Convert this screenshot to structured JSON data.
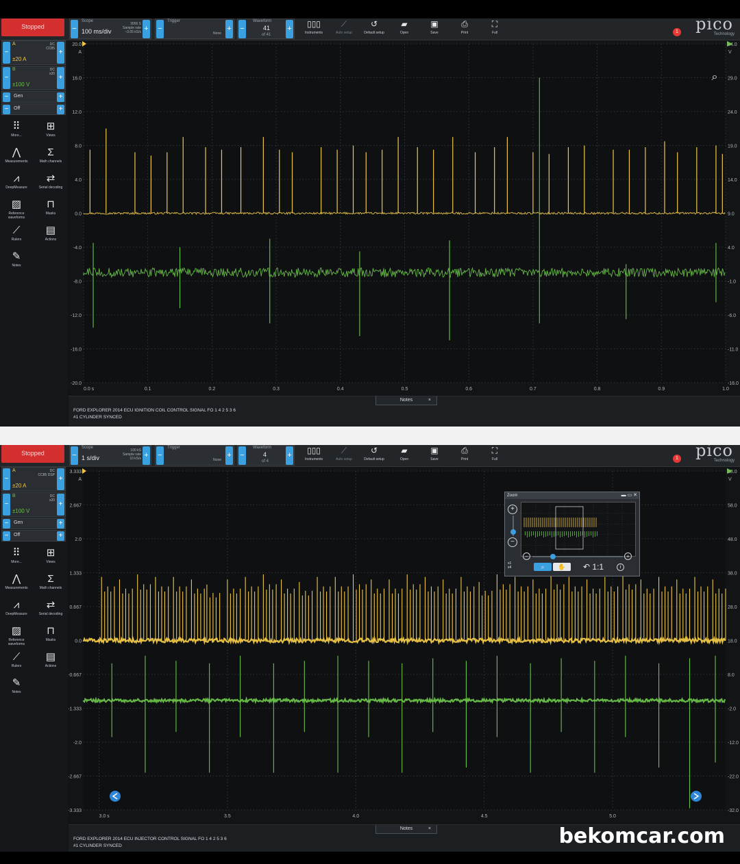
{
  "watermark": "bekomcar.com",
  "panels": [
    {
      "id": "top",
      "status": "Stopped",
      "timebase": {
        "label": "Scope",
        "value": "100 ms/div",
        "samples": "3056 S",
        "sample_rate_label": "Sample rate",
        "sample_rate": "~3.05 kS/s"
      },
      "trigger": {
        "label": "Trigger",
        "mode": "None"
      },
      "waveform": {
        "label": "Waveform",
        "index": "41",
        "of": "of 41"
      },
      "tools": [
        {
          "label": "Instruments",
          "icon": "instruments-icon",
          "dim": false
        },
        {
          "label": "Auto setup",
          "icon": "wand-icon",
          "dim": true
        },
        {
          "label": "Default setup",
          "icon": "undo-icon",
          "dim": false
        },
        {
          "label": "Open",
          "icon": "folder-icon",
          "dim": false
        },
        {
          "label": "Save",
          "icon": "save-icon",
          "dim": false
        },
        {
          "label": "Print",
          "icon": "print-icon",
          "dim": false
        },
        {
          "label": "Full",
          "icon": "fullscreen-icon",
          "dim": false
        }
      ],
      "logo": "pico",
      "logo_sub": "Technology",
      "alert_count": "1",
      "channels": [
        {
          "name": "A",
          "coupling": "DC",
          "extra": "CC85",
          "range": "±20 A",
          "color": "#f0c848"
        },
        {
          "name": "B",
          "coupling": "DC",
          "extra": "x20",
          "range": "±100 V",
          "color": "#6cc24a"
        }
      ],
      "generator": {
        "label": "Gen",
        "state": "Off"
      },
      "sidebar_buttons": [
        {
          "label": "More...",
          "glyph": "⠿",
          "icon": "more-icon"
        },
        {
          "label": "Views",
          "glyph": "⊞",
          "icon": "views-icon"
        },
        {
          "label": "Measurements",
          "glyph": "⋀",
          "icon": "measurements-icon"
        },
        {
          "label": "Math channels",
          "glyph": "Σ",
          "icon": "math-channels-icon"
        },
        {
          "label": "DeepMeasure",
          "glyph": "⩘",
          "icon": "deepmeasure-icon"
        },
        {
          "label": "Serial decoding",
          "glyph": "⇄",
          "icon": "serial-decoding-icon"
        },
        {
          "label": "Reference waveforms",
          "glyph": "▨",
          "icon": "reference-waveforms-icon"
        },
        {
          "label": "Masks",
          "glyph": "⊓",
          "icon": "masks-icon"
        },
        {
          "label": "Rulers",
          "glyph": "⟋",
          "icon": "rulers-icon"
        },
        {
          "label": "Actions",
          "glyph": "▤",
          "icon": "actions-icon"
        },
        {
          "label": "Notes",
          "glyph": "✎",
          "icon": "notes-icon"
        }
      ],
      "notes_label": "Notes",
      "notes": [
        "FORD EXPLORER 2014 ECU IGNITION COIL CONTROL SIGNAL FO 1 4 2 5 3 6",
        "#1 CYLINDER SYNCED"
      ],
      "chart_data": {
        "type": "line",
        "x_ticks": [
          "0.0 s",
          "0.1",
          "0.2",
          "0.3",
          "0.4",
          "0.5",
          "0.6",
          "0.7",
          "0.8",
          "0.9",
          "1.0"
        ],
        "xlim": [
          0,
          1.0
        ],
        "y_left_unit": "A",
        "y_left_ticks": [
          "20.0",
          "16.0",
          "12.0",
          "8.0",
          "4.0",
          "0.0",
          "-4.0",
          "-8.0",
          "-12.0",
          "-16.0",
          "-20.0"
        ],
        "ylim_left": [
          -20,
          20
        ],
        "y_right_unit": "V",
        "y_right_ticks": [
          "34.0",
          "29.0",
          "24.0",
          "19.0",
          "14.0",
          "9.0",
          "4.0",
          "-1.0",
          "-6.0",
          "-11.0",
          "-16.0"
        ],
        "grid": true,
        "series": [
          {
            "name": "A",
            "color": "#f0c848",
            "baseline": 0.0,
            "noise": 0.12,
            "spike_x": [
              0.01,
              0.035,
              0.08,
              0.105,
              0.13,
              0.155,
              0.19,
              0.215,
              0.245,
              0.28,
              0.305,
              0.325,
              0.37,
              0.395,
              0.42,
              0.44,
              0.465,
              0.49,
              0.52,
              0.545,
              0.575,
              0.61,
              0.64,
              0.66,
              0.7,
              0.725,
              0.755,
              0.78,
              0.825,
              0.85,
              0.875,
              0.905,
              0.925,
              0.955,
              0.985,
              0.995
            ],
            "spike_y": [
              7.5,
              10.0,
              7.2,
              6.8,
              7.2,
              9.0,
              7.8,
              7.5,
              7.8,
              9.0,
              7.5,
              7.2,
              7.8,
              7.5,
              8.0,
              7.2,
              7.5,
              9.0,
              7.8,
              7.5,
              9.0,
              7.2,
              7.8,
              9.0,
              7.2,
              7.0,
              7.8,
              8.0,
              7.5,
              7.5,
              7.8,
              8.5,
              7.2,
              7.8,
              8.0,
              7.0
            ]
          },
          {
            "name": "B",
            "color": "#6cc24a",
            "baseline": -7.0,
            "noise": 0.55,
            "spike_x": [
              0.015,
              0.15,
              0.29,
              0.43,
              0.57,
              0.71,
              0.845,
              0.985
            ],
            "spike_up": [
              -3.5,
              -4.0,
              -3.0,
              -4.5,
              -3.2,
              16.0,
              -6.0,
              -3.5
            ],
            "spike_down": [
              -13.5,
              -11.2,
              -13.0,
              -14.5,
              -15.0,
              -13.0,
              -12.5,
              -10.5
            ]
          }
        ]
      }
    },
    {
      "id": "bottom",
      "status": "Stopped",
      "timebase": {
        "label": "Scope",
        "value": "1 s/div",
        "samples": "100 kS",
        "sample_rate_label": "Sample rate",
        "sample_rate": "10 kS/s"
      },
      "trigger": {
        "label": "Trigger",
        "mode": "None"
      },
      "waveform": {
        "label": "Waveform",
        "index": "4",
        "of": "of 4"
      },
      "tools": [
        {
          "label": "Instruments",
          "icon": "instruments-icon",
          "dim": false
        },
        {
          "label": "Auto setup",
          "icon": "wand-icon",
          "dim": true
        },
        {
          "label": "Default setup",
          "icon": "undo-icon",
          "dim": false
        },
        {
          "label": "Open",
          "icon": "folder-icon",
          "dim": false
        },
        {
          "label": "Save",
          "icon": "save-icon",
          "dim": false
        },
        {
          "label": "Print",
          "icon": "print-icon",
          "dim": false
        },
        {
          "label": "Full",
          "icon": "fullscreen-icon",
          "dim": false
        }
      ],
      "logo": "pico",
      "logo_sub": "Technology",
      "alert_count": "1",
      "channels": [
        {
          "name": "A",
          "coupling": "DC",
          "extra": "CC85 DSP",
          "range": "±20 A",
          "color": "#f0c848"
        },
        {
          "name": "B",
          "coupling": "DC",
          "extra": "x20",
          "range": "±100 V",
          "color": "#6cc24a"
        }
      ],
      "generator": {
        "label": "Gen",
        "state": "Off"
      },
      "sidebar_buttons": [
        {
          "label": "More...",
          "glyph": "⠿",
          "icon": "more-icon"
        },
        {
          "label": "Views",
          "glyph": "⊞",
          "icon": "views-icon"
        },
        {
          "label": "Measurements",
          "glyph": "⋀",
          "icon": "measurements-icon"
        },
        {
          "label": "Math channels",
          "glyph": "Σ",
          "icon": "math-channels-icon"
        },
        {
          "label": "DeepMeasure",
          "glyph": "⩘",
          "icon": "deepmeasure-icon"
        },
        {
          "label": "Serial decoding",
          "glyph": "⇄",
          "icon": "serial-decoding-icon"
        },
        {
          "label": "Reference waveforms",
          "glyph": "▨",
          "icon": "reference-waveforms-icon"
        },
        {
          "label": "Masks",
          "glyph": "⊓",
          "icon": "masks-icon"
        },
        {
          "label": "Rulers",
          "glyph": "⟋",
          "icon": "rulers-icon"
        },
        {
          "label": "Actions",
          "glyph": "▤",
          "icon": "actions-icon"
        },
        {
          "label": "Notes",
          "glyph": "✎",
          "icon": "notes-icon"
        }
      ],
      "notes_label": "Notes",
      "notes": [
        "FORD EXPLORER 2014 ECU INJECTOR CONTROL SIGNAL FO 1 4 2 5 3 6",
        "#1 CYLINDER SYNCED"
      ],
      "zoom_overview": {
        "title": "Zoom",
        "ratio": "1:1",
        "x1": "x1",
        "x4": "x4"
      },
      "chart_data": {
        "type": "line",
        "x_ticks": [
          "3.0 s",
          "3.5",
          "4.0",
          "4.5",
          "5.0"
        ],
        "x_tick_values": [
          3.0,
          3.5,
          4.0,
          4.5,
          5.0
        ],
        "xlim": [
          2.94,
          5.44
        ],
        "y_left_unit": "A",
        "y_left_ticks": [
          "3.333",
          "2.667",
          "2.0",
          "1.333",
          "0.667",
          "0.0",
          "-0.667",
          "-1.333",
          "-2.0",
          "-2.667",
          "-3.333"
        ],
        "ylim_left": [
          -3.333,
          3.333
        ],
        "y_right_unit": "V",
        "y_right_ticks": [
          "68.0",
          "58.0",
          "48.0",
          "38.0",
          "28.0",
          "18.0",
          "8.0",
          "-2.0",
          "-12.0",
          "-22.0",
          "-32.0"
        ],
        "grid": true,
        "series": [
          {
            "name": "A",
            "color": "#f0c848",
            "baseline": 0.0,
            "noise": 0.04,
            "burst_x": [
              3.01,
              3.08,
              3.15,
              3.22,
              3.29,
              3.36,
              3.42,
              3.5,
              3.57,
              3.64,
              3.71,
              3.78,
              3.85,
              3.92,
              3.99,
              4.06,
              4.13,
              4.2,
              4.27,
              4.34,
              4.41,
              4.48,
              4.55,
              4.62,
              4.69,
              4.76,
              4.83,
              4.9,
              4.97,
              5.04,
              5.11,
              5.18,
              5.25,
              5.32,
              5.39
            ],
            "burst_y": [
              1.25,
              1.2,
              1.3,
              1.25,
              1.25,
              1.2,
              1.1,
              1.2,
              1.25,
              1.3,
              1.2,
              1.15,
              1.25,
              1.25,
              1.3,
              1.2,
              1.2,
              1.3,
              1.25,
              1.2,
              1.25,
              1.15,
              1.3,
              1.25,
              1.2,
              1.3,
              1.25,
              1.2,
              1.25,
              1.3,
              1.2,
              1.25,
              1.2,
              1.25,
              1.2
            ]
          },
          {
            "name": "B",
            "color": "#6cc24a",
            "baseline": -1.18,
            "noise": 0.03,
            "spike_x": [
              3.05,
              3.18,
              3.3,
              3.43,
              3.55,
              3.68,
              3.8,
              3.93,
              4.05,
              4.18,
              4.3,
              4.43,
              4.55,
              4.68,
              4.8,
              4.93,
              5.05,
              5.18,
              5.3,
              5.4
            ],
            "spike_up": [
              -0.45,
              -0.3,
              -0.4,
              -0.45,
              -0.3,
              -0.45,
              -0.4,
              -0.3,
              -0.4,
              -0.45,
              -0.35,
              -0.4,
              -0.3,
              -0.45,
              -0.35,
              -0.4,
              -0.3,
              -0.45,
              -0.35,
              -0.3
            ],
            "spike_down": [
              -1.9,
              -2.6,
              -1.8,
              -2.6,
              -1.9,
              -2.6,
              -1.8,
              -2.6,
              -1.9,
              -2.6,
              -1.8,
              -2.5,
              -1.9,
              -2.6,
              -1.8,
              -2.6,
              -1.9,
              -2.5,
              -3.3,
              -2.4
            ]
          }
        ]
      }
    }
  ]
}
